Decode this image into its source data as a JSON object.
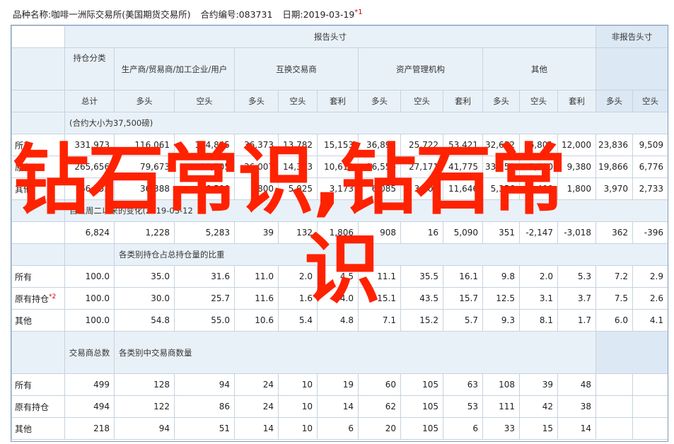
{
  "meta": {
    "variety_label": "品种名称:",
    "variety": "咖啡一洲际交易所(美国期货交易所)",
    "code_label": "合约编号:",
    "code": "083731",
    "date_label": "日期:",
    "date": "2019-03-19",
    "date_note": "*1"
  },
  "headers": {
    "report": "报告头寸",
    "nonreport": "非报告头寸",
    "category": "持仓分类",
    "producer": "生产商/贸易商/加工企业/用户",
    "swap": "互换交易商",
    "asset": "资产管理机构",
    "other": "其他",
    "total": "总计",
    "long": "多头",
    "short": "空头",
    "spread": "套利"
  },
  "section1": {
    "note": "(合约大小为37,500磅)",
    "rows": [
      {
        "label": "所有",
        "cells": [
          "331,973",
          "116,061",
          "104,845",
          "36,373",
          "13,782",
          "15,153",
          "36,895",
          "25,722",
          "53,421",
          "32,622",
          "6,801",
          "12,000",
          "23,836",
          "9,509"
        ]
      },
      {
        "label": "原有",
        "cells": [
          "265,656",
          "79,673",
          "80,705",
          "36,007",
          "14,373",
          "10,619",
          "36,556",
          "27,171",
          "41,775",
          "33,259",
          "5,900",
          "9,380",
          "19,866",
          "6,776"
        ]
      },
      {
        "label": "其他",
        "cells": [
          "66,353",
          "36,388",
          "26,590",
          "800",
          "5,025",
          "3,173",
          "6,085",
          "3,900",
          "11,646",
          "5,356",
          "5,400",
          "1,800",
          "3,970",
          "2,733"
        ]
      }
    ]
  },
  "section2": {
    "note": "自上周二以来的变化(2019-03-12",
    "cells": [
      "6,824",
      "1,228",
      "5,283",
      "39",
      "132",
      "1,806",
      "908",
      "16",
      "5,090",
      "351",
      "-2,147",
      "-3,018",
      "362",
      "-396"
    ]
  },
  "section3": {
    "note": "各类别持仓占总持仓量的比重",
    "rows": [
      {
        "label": "所有",
        "note": "",
        "cells": [
          "100.0",
          "35.0",
          "31.6",
          "11.0",
          "2.0",
          "4.5",
          "11.1",
          "35.5",
          "16.1",
          "9.8",
          "2.0",
          "5.3",
          "7.2",
          "2.9"
        ]
      },
      {
        "label": "原有持仓",
        "note": "*2",
        "cells": [
          "100.0",
          "30.0",
          "25.7",
          "11.6",
          "1.6",
          "4.0",
          "15.1",
          "43.5",
          "15.7",
          "12.5",
          "3.1",
          "3.7",
          "7.5",
          "2.6"
        ]
      },
      {
        "label": "其他",
        "note": "",
        "cells": [
          "100.0",
          "54.8",
          "55.0",
          "10.6",
          "5.4",
          "4.8",
          "7.1",
          "15.2",
          "5.7",
          "9.3",
          "8.1",
          "1.7",
          "6.0",
          "4.1"
        ]
      }
    ]
  },
  "section4": {
    "total_label": "交易商总数",
    "note": "各类别中交易商数量",
    "rows": [
      {
        "label": "所有",
        "cells": [
          "499",
          "128",
          "94",
          "24",
          "10",
          "19",
          "60",
          "105",
          "63",
          "108",
          "39",
          "48",
          "",
          ""
        ]
      },
      {
        "label": "原有持仓",
        "cells": [
          "494",
          "122",
          "86",
          "24",
          "10",
          "14",
          "62",
          "105",
          "53",
          "111",
          "42",
          "38",
          "",
          ""
        ]
      },
      {
        "label": "其他",
        "cells": [
          "218",
          "94",
          "51",
          "14",
          "10",
          "6",
          "20",
          "105",
          "6",
          "33",
          "15",
          "14",
          "",
          ""
        ]
      }
    ]
  },
  "watermark": {
    "line1": "钻石常识,钻石常",
    "line2": "识"
  },
  "colors": {
    "header_bg": "#e9f1f8",
    "border": "#c5d3e0",
    "watermark": "#ff2200",
    "note_red": "#cc0000"
  }
}
